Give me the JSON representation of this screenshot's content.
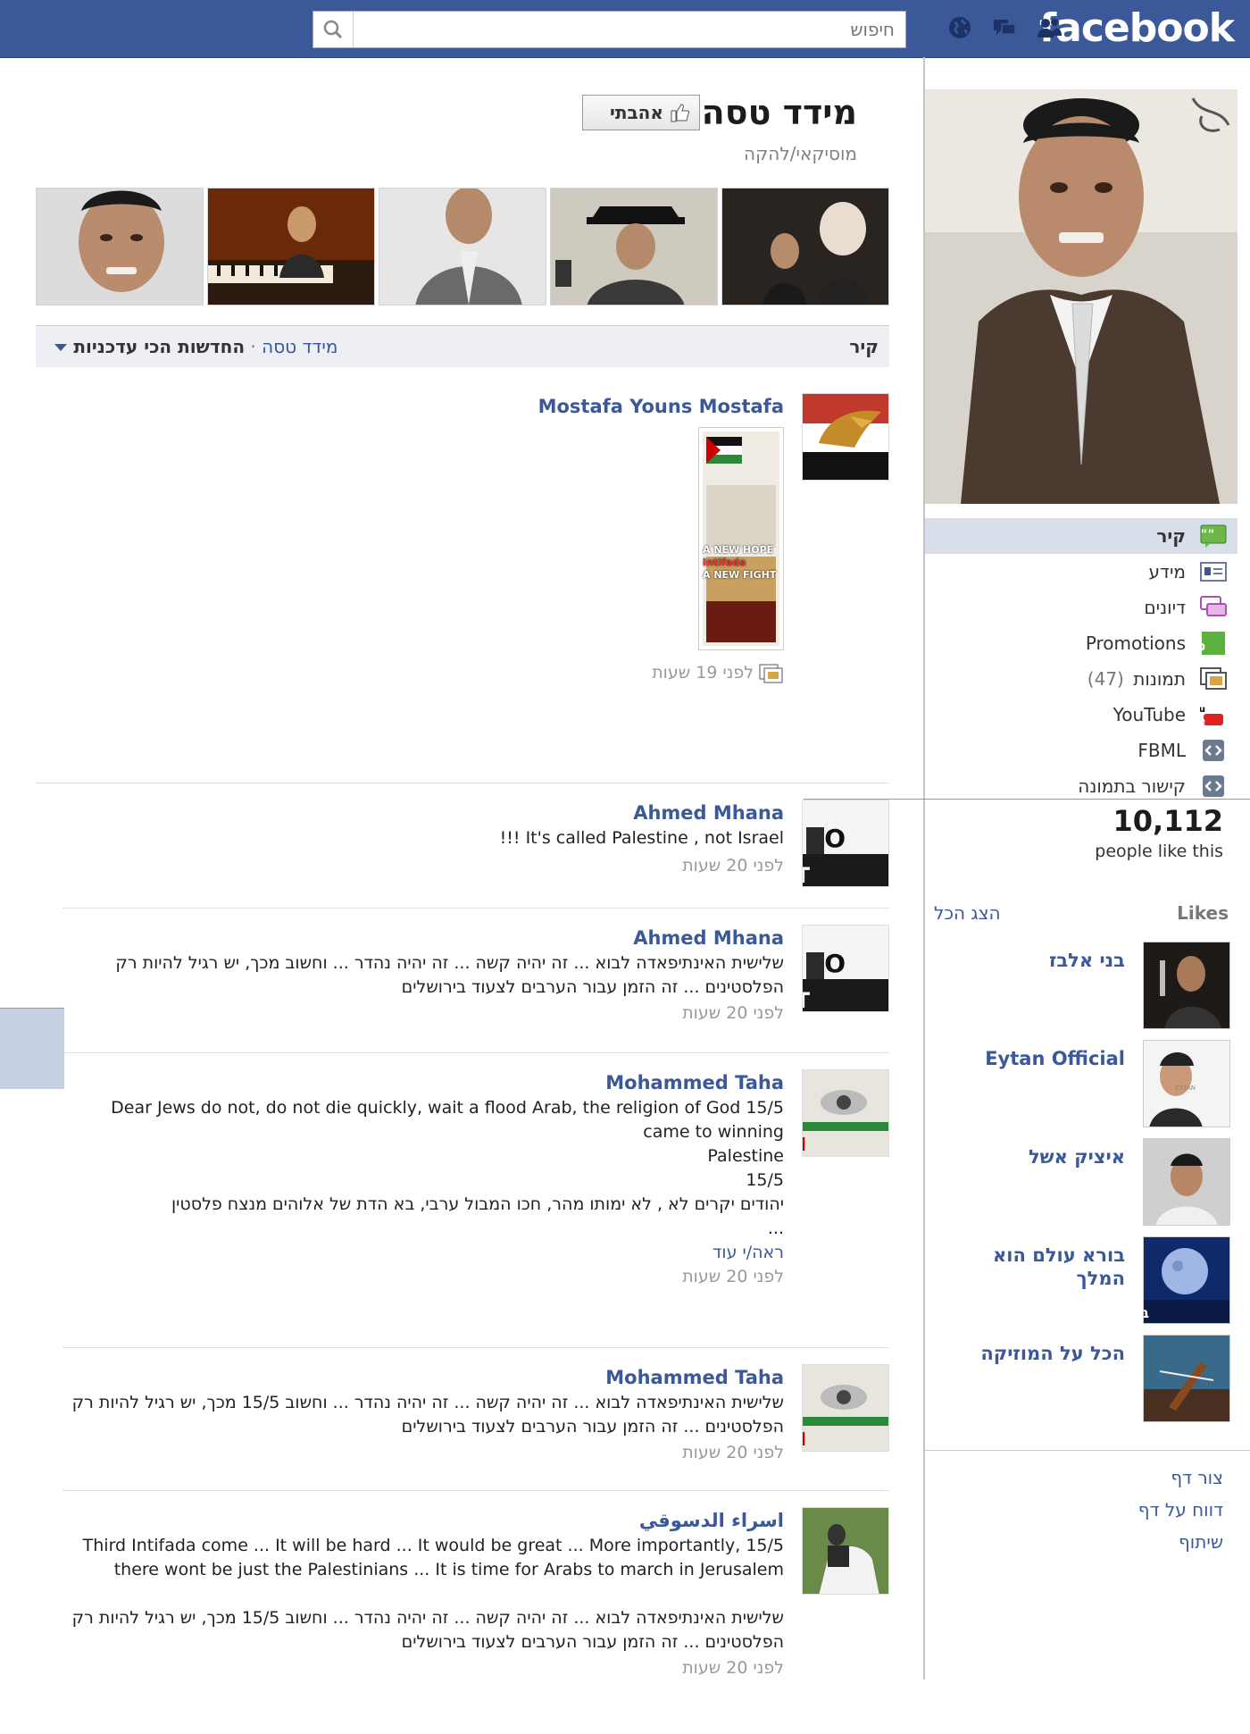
{
  "topbar": {
    "logo": "facebook",
    "search_placeholder": "חיפוש",
    "colors": {
      "bar": "#3b5998",
      "link": "#3b5998"
    }
  },
  "page": {
    "title": "מידד טסה",
    "category": "מוסיקאי/להקה",
    "like_button": "אהבתי"
  },
  "wall": {
    "title": "קיר",
    "filter_name": "מידד טסה",
    "filter_selected": "החדשות הכי עדכניות"
  },
  "sidenav": [
    {
      "label": "קיר",
      "icon": "wall-icon"
    },
    {
      "label": "מידע",
      "icon": "info-icon"
    },
    {
      "label": "דיונים",
      "icon": "discussions-icon"
    },
    {
      "label": "Promotions",
      "icon": "promotions-icon"
    },
    {
      "label": "תמונות",
      "count": "(47)",
      "icon": "photos-icon"
    },
    {
      "label": "YouTube",
      "icon": "youtube-icon"
    },
    {
      "label": "FBML",
      "icon": "fbml-icon"
    },
    {
      "label": "קישור בתמונה",
      "icon": "link-icon"
    }
  ],
  "stats": {
    "count": "10,112",
    "label": "people like this"
  },
  "likes": {
    "title": "Likes",
    "see_all": "הצג הכל",
    "items": [
      {
        "name": "בני אלבז"
      },
      {
        "name": "Eytan Official"
      },
      {
        "name": "איציק אשל"
      },
      {
        "name": "בורא עולם הוא המלך"
      },
      {
        "name": "הכל על המוזיקה"
      }
    ]
  },
  "footer_links": [
    "צור דף",
    "דווח על דף",
    "שיתוף"
  ],
  "posts": [
    {
      "author": "Mostafa Youns Mostafa",
      "text": "",
      "time": "לפני 19 שעות",
      "attachment_text": [
        "A NEW HOPE",
        "Intifada",
        "A NEW FIGHT"
      ]
    },
    {
      "author": "Ahmed Mhana",
      "text": "It's called Palestine , not Israel !!!",
      "time": "לפני 20 שעות"
    },
    {
      "author": "Ahmed Mhana",
      "text": "שלישית האינתיפאדה לבוא ... זה יהיה קשה ... זה יהיה נהדר ... וחשוב מכך, יש רגיל להיות רק הפלסטינים ... זה הזמן עבור הערבים לצעוד בירושלים",
      "time": "לפני 20 שעות"
    },
    {
      "author": "Mohammed Taha",
      "text": "15/5 Dear Jews do not, do not die quickly, wait a flood Arab, the religion of God came to winning\nPalestine\n15/5\nיהודים יקרים לא , לא ימותו מהר, חכו המבול ערבי, בא הדת של אלוהים מנצח פלסטין\n...",
      "see_more": "ראה/י עוד",
      "time": "לפני 20 שעות"
    },
    {
      "author": "Mohammed Taha",
      "text": "שלישית האינתיפאדה לבוא ... זה יהיה קשה ... זה יהיה נהדר ... וחשוב 15/5 מכך, יש רגיל להיות רק הפלסטינים ... זה הזמן עבור הערבים לצעוד בירושלים",
      "time": "לפני 20 שעות"
    },
    {
      "author": "اسراء الدسوقي",
      "text": "15/5 Third Intifada come ... It will be hard ... It would be great ... More importantly, there wont be just the Palestinians ... It is time for Arabs to march in Jerusalem\n\nשלישית האינתיפאדה לבוא ... זה יהיה קשה ... זה יהיה נהדר ... וחשוב 15/5 מכך, יש רגיל להיות רק הפלסטינים ... זה הזמן עבור הערבים לצעוד בירושלים",
      "time": "לפני 20 שעות"
    }
  ]
}
